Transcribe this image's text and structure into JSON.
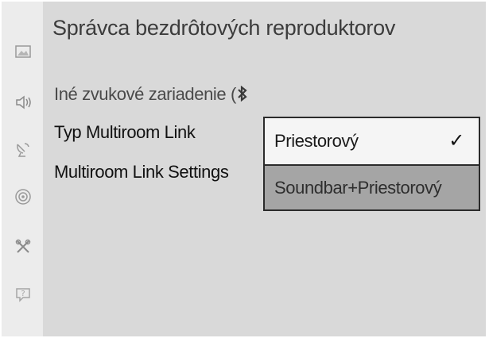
{
  "header": {
    "title": "Správca bezdrôtových reproduktorov"
  },
  "sidebar": {
    "icons": [
      "picture-icon",
      "sound-icon",
      "broadcast-icon",
      "network-icon",
      "tools-icon",
      "support-icon"
    ]
  },
  "menu": {
    "items": [
      {
        "label": "Iné zvukové zariadenie ("
      },
      {
        "label": "Typ Multiroom Link"
      },
      {
        "label": "Multiroom Link Settings"
      }
    ]
  },
  "dropdown": {
    "options": [
      {
        "label": "Priestorový",
        "check": "✓"
      },
      {
        "label": "Soundbar+Priestorový"
      }
    ]
  }
}
